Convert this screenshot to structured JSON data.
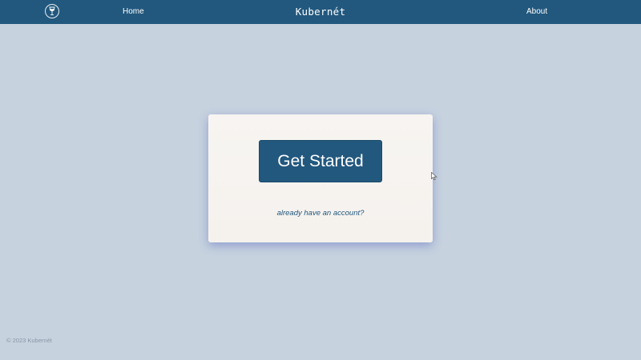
{
  "navbar": {
    "logo_icon": "wine-glass-icon",
    "home_label": "Home",
    "brand": "Kubernét",
    "about_label": "About"
  },
  "card": {
    "cta_label": "Get Started",
    "login_link": "already have an account?"
  },
  "footer": {
    "copyright": "© 2023 Kubernét"
  },
  "colors": {
    "navbar_bg": "#22587e",
    "page_bg": "#c6d2de",
    "card_bg": "#f7f4f1",
    "accent": "#22587e"
  }
}
